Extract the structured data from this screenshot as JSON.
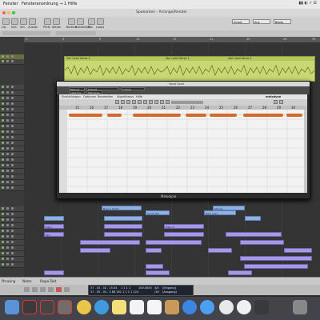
{
  "menubar": {
    "items": [
      "Fenster",
      "Fensteranordnung → 1",
      "Hilfe"
    ]
  },
  "window": {
    "title": "Spaeamen - Arrange/Render"
  },
  "toolbar": {
    "labels": [
      "Lib.",
      "Info",
      "Sm.",
      "Zusatz",
      "Prefs",
      "Aktion",
      "Bereich",
      "Bearbeiten",
      "Mix",
      "Loops"
    ],
    "right_fields": [
      "Smart",
      "Aus",
      "Beats"
    ]
  },
  "ruler": {
    "ticks": [
      "1",
      "5",
      "9",
      "13",
      "17",
      "21",
      "25",
      "29",
      "33"
    ]
  },
  "audio_region": {
    "names": [
      "Vox Lead Verse 1",
      "Vox Lead Verse 1",
      "Vox Lead Verse 1"
    ]
  },
  "melodyne": {
    "window_title": "Vocal Lead",
    "plugbar": [
      "Manual",
      "Default",
      "Cubase",
      "Lead Vox",
      "Melodyne"
    ],
    "menu": [
      "Einstellungen",
      "Optionen",
      "Bearbeiten",
      "Algorithmus",
      "Hilfe"
    ],
    "brand": "Melodyne",
    "logo": "melodyne",
    "bar_numbers": [
      "15",
      "16",
      "17",
      "18",
      "19",
      "20",
      "21",
      "22",
      "23",
      "24",
      "25",
      "26",
      "27",
      "28",
      "29",
      "30",
      "31"
    ]
  },
  "midi_regions": [
    {
      "label": "Bass 1 Synth"
    },
    {
      "label": "Synth Pad"
    },
    {
      "label": "Bass Lead"
    },
    {
      "label": "Strings"
    },
    {
      "label": "Piano"
    },
    {
      "label": "Piano 2"
    },
    {
      "label": "Pad"
    }
  ],
  "bottom": {
    "labels": [
      "Phrasing",
      "Notes",
      "Regio-Takt"
    ]
  },
  "lcd": {
    "position": "37 . 03 . 02 . 15.04",
    "bar": "1   1   1   1",
    "tempo": "100.0000",
    "sig": "4/4",
    "key": "(Eingang)",
    "out": "(Ausgang)",
    "row2": "37 . 05 . 04 . 3 88   181   1   1   1   1   124",
    "tempo2": "120",
    "div": "/16"
  },
  "dock": {
    "apps": [
      "finder",
      "logic",
      "stack",
      "systempref",
      "chrome",
      "safari",
      "notes",
      "photos",
      "calendar",
      "mail",
      "contacts",
      "itunes",
      "appstore",
      "activity",
      "terminal"
    ]
  }
}
